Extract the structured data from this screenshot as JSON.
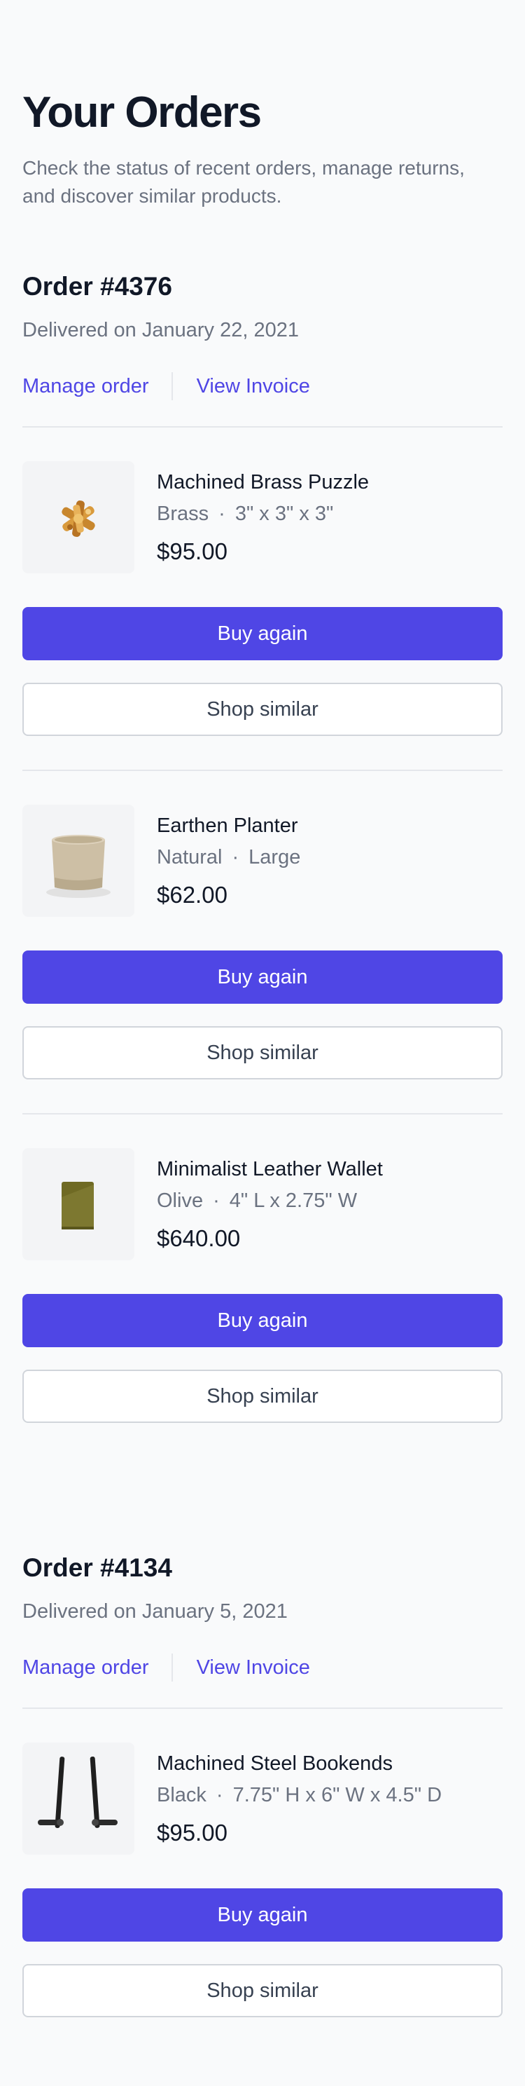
{
  "header": {
    "title": "Your Orders",
    "subtitle": "Check the status of recent orders, manage returns, and discover similar products."
  },
  "orders": [
    {
      "id": "Order #4376",
      "date": "Delivered on January 22, 2021",
      "manage_label": "Manage order",
      "invoice_label": "View Invoice",
      "items": [
        {
          "name": "Machined Brass Puzzle",
          "variant": "Brass",
          "size": "3\" x 3\" x 3\"",
          "price": "$95.00",
          "buy_label": "Buy again",
          "shop_label": "Shop similar",
          "icon": "brass-puzzle-image"
        },
        {
          "name": "Earthen Planter",
          "variant": "Natural",
          "size": "Large",
          "price": "$62.00",
          "buy_label": "Buy again",
          "shop_label": "Shop similar",
          "icon": "planter-image"
        },
        {
          "name": "Minimalist Leather Wallet",
          "variant": "Olive",
          "size": "4\" L x 2.75\" W",
          "price": "$640.00",
          "buy_label": "Buy again",
          "shop_label": "Shop similar",
          "icon": "wallet-image"
        }
      ]
    },
    {
      "id": "Order #4134",
      "date": "Delivered on January 5, 2021",
      "manage_label": "Manage order",
      "invoice_label": "View Invoice",
      "items": [
        {
          "name": "Machined Steel Bookends",
          "variant": "Black",
          "size": "7.75\" H x 6\" W x 4.5\" D",
          "price": "$95.00",
          "buy_label": "Buy again",
          "shop_label": "Shop similar",
          "icon": "bookends-image"
        }
      ]
    }
  ],
  "colors": {
    "accent": "#4f46e5",
    "text_primary": "#111827",
    "text_muted": "#6b7280",
    "border": "#e5e7eb",
    "background": "#f9fafb"
  }
}
